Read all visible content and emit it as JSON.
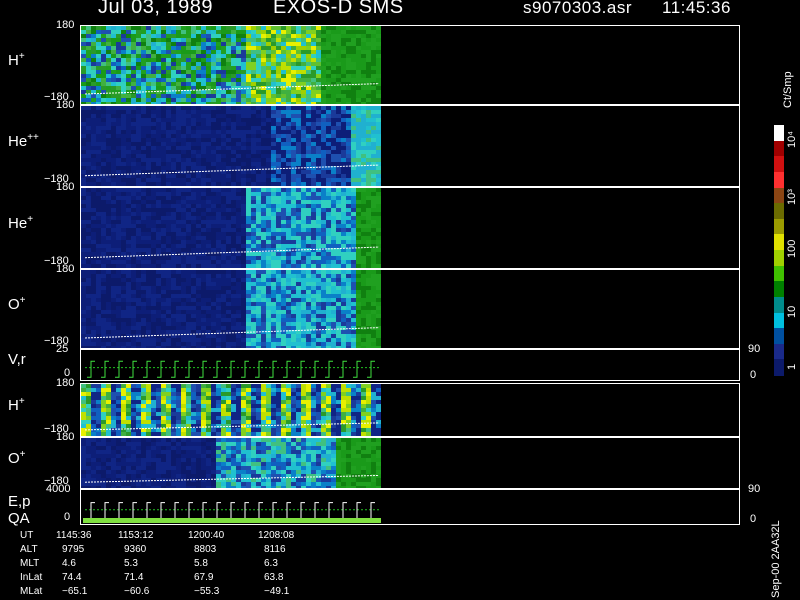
{
  "header": {
    "date": "Jul 03, 1989",
    "instrument": "EXOS-D SMS",
    "file": "s9070303.asr",
    "time": "11:45:36"
  },
  "panels": [
    {
      "id": "hplus",
      "name": "H",
      "sup": "+",
      "top": "180",
      "bot": "−180"
    },
    {
      "id": "hepp",
      "name": "He",
      "sup": "++",
      "top": "180",
      "bot": "−180"
    },
    {
      "id": "hep",
      "name": "He",
      "sup": "+",
      "top": "180",
      "bot": "−180"
    },
    {
      "id": "oplus",
      "name": "O",
      "sup": "+",
      "top": "180",
      "bot": "−180"
    },
    {
      "id": "vr",
      "name": "V,r",
      "sup": "",
      "top": "25",
      "bot": "0",
      "right_top": "90",
      "right_bot": "0"
    },
    {
      "id": "hplus2",
      "name": "H",
      "sup": "+",
      "top": "180",
      "bot": "−180"
    },
    {
      "id": "oplus2",
      "name": "O",
      "sup": "+",
      "top": "180",
      "bot": "−180"
    },
    {
      "id": "ep",
      "name": "E,p",
      "sup": "",
      "name2": "QA",
      "top": "4000",
      "bot": "0",
      "right_top": "90",
      "right_bot": "0"
    }
  ],
  "colorbar": {
    "unit": "Ct/Smp",
    "labels": [
      "10⁴",
      "10³",
      "100",
      "10",
      "1"
    ],
    "colors": [
      "#ffffff",
      "#a00000",
      "#d01010",
      "#ff3030",
      "#8b4513",
      "#6b6b00",
      "#9b9b00",
      "#e0e000",
      "#a0d000",
      "#40c000",
      "#008000",
      "#008b8b",
      "#00c0e0",
      "#0050a0",
      "#1a2a8a",
      "#0c1a6a"
    ]
  },
  "ephemeris": {
    "rows": [
      {
        "label": "UT",
        "values": [
          "1145:36",
          "1153:12",
          "1200:40",
          "1208:08"
        ]
      },
      {
        "label": "ALT",
        "values": [
          "9795",
          "9360",
          "8803",
          "8116"
        ]
      },
      {
        "label": "MLT",
        "values": [
          "4.6",
          "5.3",
          "5.8",
          "6.3"
        ]
      },
      {
        "label": "InLat",
        "values": [
          "74.4",
          "71.4",
          "67.9",
          "63.8"
        ]
      },
      {
        "label": "MLat",
        "values": [
          "−65.1",
          "−60.6",
          "−55.3",
          "−49.1"
        ]
      }
    ]
  },
  "footer_code": "Sep-00  2AA32L",
  "chart_data": {
    "type": "heatmap",
    "title": "Jul 03, 1989   EXOS-D SMS",
    "subtitle": "s9070303.asr  11:45:36",
    "x_ticks": [
      "1145:36",
      "1153:12",
      "1200:40",
      "1208:08"
    ],
    "colorbar_scale": "log",
    "colorbar_range": [
      1,
      10000
    ],
    "colorbar_unit": "Ct/Smp",
    "series": [
      {
        "name": "H+",
        "yrange": [
          -180,
          180
        ]
      },
      {
        "name": "He++",
        "yrange": [
          -180,
          180
        ]
      },
      {
        "name": "He+",
        "yrange": [
          -180,
          180
        ]
      },
      {
        "name": "O+",
        "yrange": [
          -180,
          180
        ]
      },
      {
        "name": "V,r",
        "yrange": [
          0,
          25
        ],
        "y2range": [
          0,
          90
        ]
      },
      {
        "name": "H+",
        "yrange": [
          -180,
          180
        ]
      },
      {
        "name": "O+",
        "yrange": [
          -180,
          180
        ]
      },
      {
        "name": "E,p",
        "yrange": [
          0,
          4000
        ],
        "y2range": [
          0,
          90
        ]
      }
    ]
  }
}
